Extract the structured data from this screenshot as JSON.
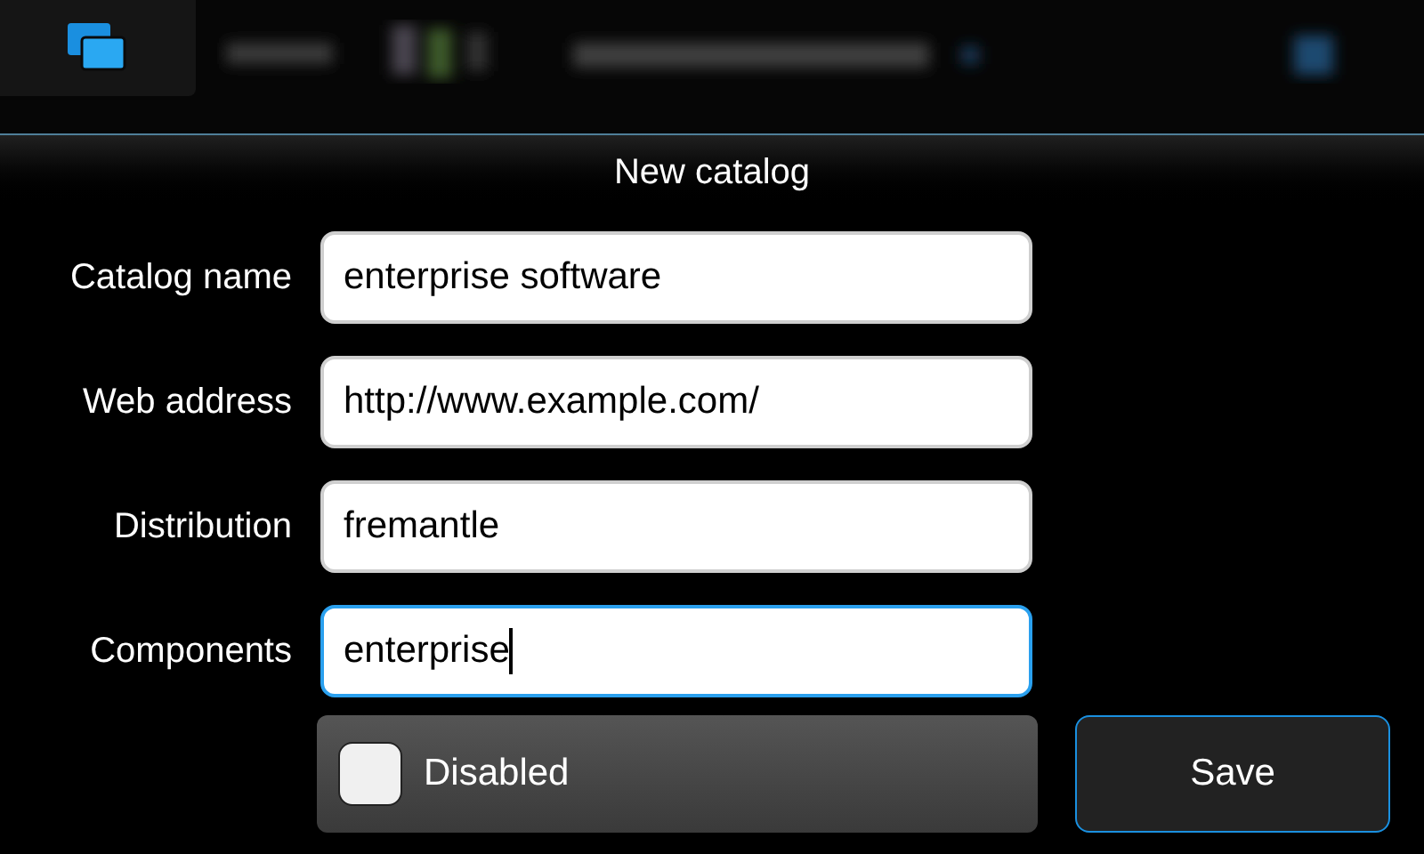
{
  "title": "New catalog",
  "fields": [
    {
      "label": "Catalog name",
      "value": "enterprise software",
      "focused": false
    },
    {
      "label": "Web address",
      "value": "http://www.example.com/",
      "focused": false
    },
    {
      "label": "Distribution",
      "value": "fremantle",
      "focused": false
    },
    {
      "label": "Components",
      "value": "enterprise",
      "focused": true
    }
  ],
  "checkbox": {
    "label": "Disabled",
    "checked": false
  },
  "save_button": "Save"
}
